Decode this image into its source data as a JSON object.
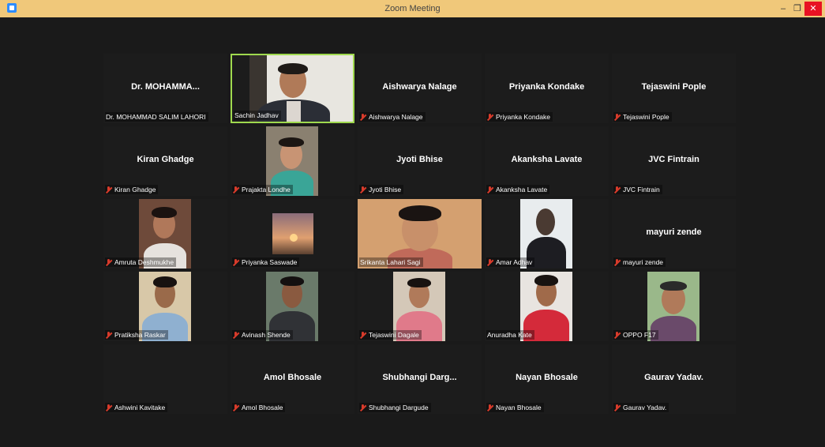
{
  "window": {
    "title": "Zoom Meeting",
    "controls": {
      "minimize": "–",
      "restore": "❐",
      "close": "✕"
    }
  },
  "participants": [
    {
      "display": "Dr.  MOHAMMA...",
      "label": "Dr. MOHAMMAD SALIM LAHORI",
      "muted": false,
      "video": false
    },
    {
      "display": "",
      "label": "Sachin Jadhav",
      "muted": false,
      "video": true,
      "active": true
    },
    {
      "display": "Aishwarya Nalage",
      "label": "Aishwarya Nalage",
      "muted": true,
      "video": false
    },
    {
      "display": "Priyanka Kondake",
      "label": "Priyanka Kondake",
      "muted": true,
      "video": false
    },
    {
      "display": "Tejaswini Pople",
      "label": "Tejaswini Pople",
      "muted": true,
      "video": false
    },
    {
      "display": "Kiran Ghadge",
      "label": "Kiran Ghadge",
      "muted": true,
      "video": false
    },
    {
      "display": "",
      "label": "Prajakta Londhe",
      "muted": true,
      "video": true
    },
    {
      "display": "Jyoti Bhise",
      "label": "Jyoti Bhise",
      "muted": true,
      "video": false
    },
    {
      "display": "Akanksha Lavate",
      "label": "Akanksha Lavate",
      "muted": true,
      "video": false
    },
    {
      "display": "JVC Fintrain",
      "label": "JVC Fintrain",
      "muted": true,
      "video": false
    },
    {
      "display": "",
      "label": "Amruta Deshmukhe",
      "muted": true,
      "video": true
    },
    {
      "display": "",
      "label": "Priyanka Saswade",
      "muted": true,
      "video": true
    },
    {
      "display": "",
      "label": "Srikanta Lahari Sagi",
      "muted": false,
      "video": true
    },
    {
      "display": "",
      "label": "Amar Adhav",
      "muted": true,
      "video": true
    },
    {
      "display": "mayuri zende",
      "label": "mayuri zende",
      "muted": true,
      "video": false
    },
    {
      "display": "",
      "label": "Pratiksha Raskar",
      "muted": true,
      "video": true
    },
    {
      "display": "",
      "label": "Avinash Shende",
      "muted": true,
      "video": true
    },
    {
      "display": "",
      "label": "Tejaswini Dagale",
      "muted": true,
      "video": true
    },
    {
      "display": "",
      "label": "Anuradha Kate",
      "muted": false,
      "video": true
    },
    {
      "display": "",
      "label": "OPPO F17",
      "muted": true,
      "video": true
    },
    {
      "display": "",
      "label": "Ashwini Kavitake",
      "muted": true,
      "video": false
    },
    {
      "display": "Amol Bhosale",
      "label": "Amol Bhosale",
      "muted": true,
      "video": false
    },
    {
      "display": "Shubhangi  Darg...",
      "label": "Shubhangi Dargude",
      "muted": true,
      "video": false
    },
    {
      "display": "Nayan Bhosale",
      "label": "Nayan Bhosale",
      "muted": true,
      "video": false
    },
    {
      "display": "Gaurav Yadav.",
      "label": "Gaurav Yadav.",
      "muted": true,
      "video": false
    }
  ]
}
